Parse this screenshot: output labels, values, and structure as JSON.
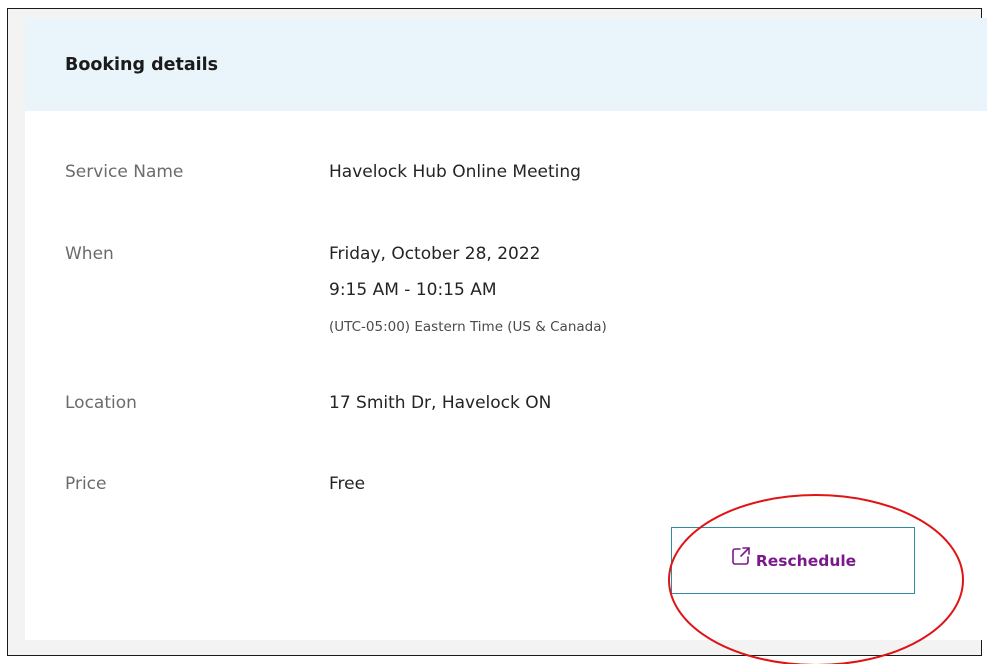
{
  "booking": {
    "title": "Booking details",
    "rows": [
      {
        "label": "Service Name",
        "value": "Havelock Hub Online Meeting"
      },
      {
        "label": "When",
        "value": "Friday, October 28, 2022",
        "value2": "9:15 AM - 10:15 AM",
        "sub": "(UTC-05:00) Eastern Time (US & Canada)"
      },
      {
        "label": "Location",
        "value": "17 Smith Dr, Havelock ON"
      },
      {
        "label": "Price",
        "value": "Free"
      }
    ],
    "reschedule_label": "Reschedule",
    "reschedule_icon": "external-link-icon"
  },
  "colors": {
    "header_bg": "#eaf5fb",
    "button_border": "#2f8ca0",
    "button_text": "#7a1a8a",
    "annotation": "#e01414"
  }
}
